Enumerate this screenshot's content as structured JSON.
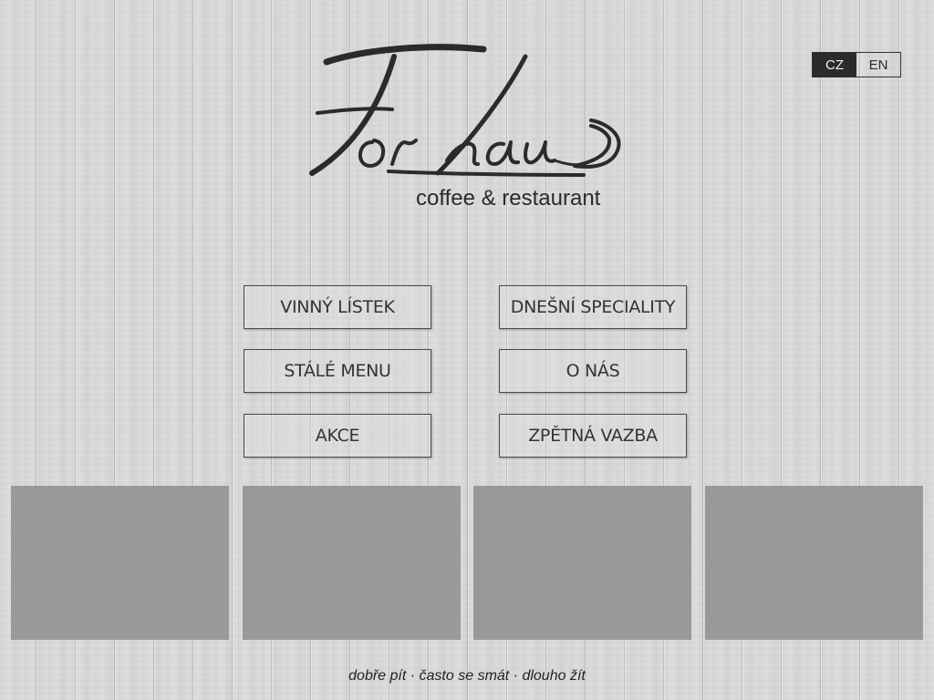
{
  "language_switch": {
    "options": [
      {
        "label": "CZ",
        "active": true
      },
      {
        "label": "EN",
        "active": false
      }
    ]
  },
  "logo": {
    "name": "Forhaus",
    "subtitle": "coffee & restaurant"
  },
  "menu": {
    "items": [
      {
        "label": "VINNÝ LÍSTEK"
      },
      {
        "label": "DNEŠNÍ SPECIALITY"
      },
      {
        "label": "STÁLÉ MENU"
      },
      {
        "label": "O NÁS"
      },
      {
        "label": "AKCE"
      },
      {
        "label": "ZPĚTNÁ VAZBA"
      }
    ]
  },
  "tiles": {
    "count": 4,
    "color": "#999999"
  },
  "footer": {
    "slogan": "dobře pít · často se smát · dlouho žít"
  },
  "colors": {
    "text_dark": "#2b2b2b",
    "active_lang_bg": "#2b2b2b",
    "tile": "#999999"
  }
}
